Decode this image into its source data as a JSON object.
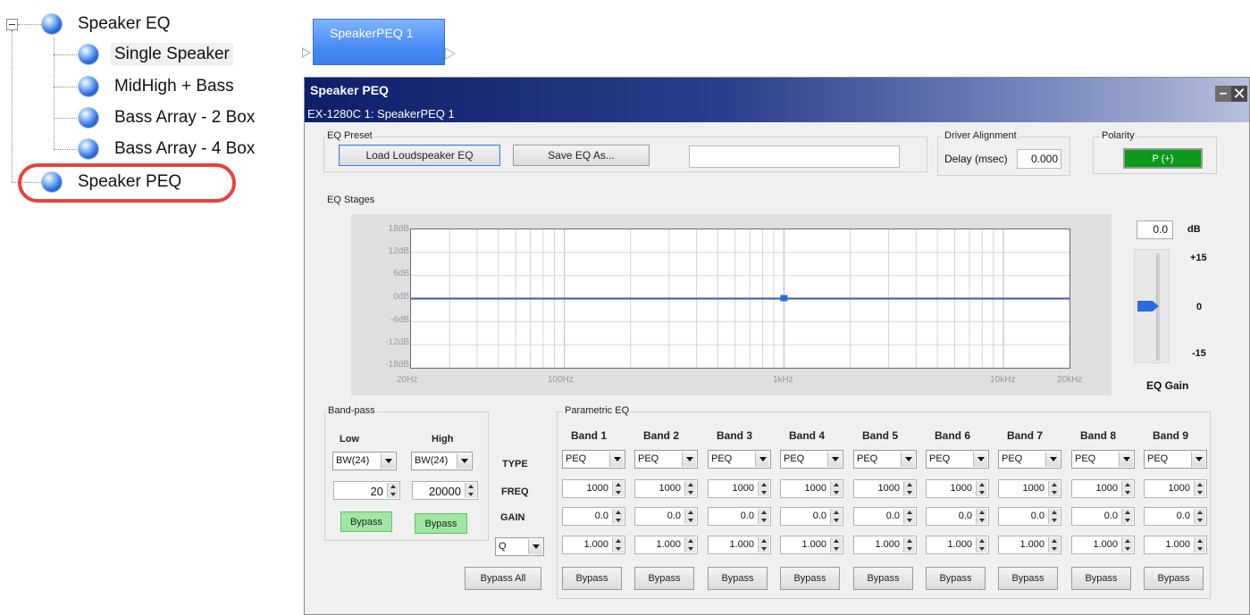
{
  "tree": {
    "root": "Speaker EQ",
    "children": [
      "Single Speaker",
      "MidHigh + Bass",
      "Bass Array - 2 Box",
      "Bass Array - 4 Box"
    ],
    "sibling": "Speaker PEQ"
  },
  "block": {
    "label": "SpeakerPEQ 1"
  },
  "dialog": {
    "title": "Speaker PEQ",
    "subtitle": "EX-1280C 1: SpeakerPEQ 1",
    "minimize": "–",
    "close": "✕",
    "eq_preset": {
      "label": "EQ Preset",
      "load_button": "Load Loudspeaker EQ",
      "save_button": "Save EQ As...",
      "preset_name": ""
    },
    "driver_alignment": {
      "label": "Driver Alignment",
      "delay_label": "Delay (msec)",
      "delay_value": "0.000"
    },
    "polarity": {
      "label": "Polarity",
      "value": "P (+)"
    },
    "eq_stages": {
      "label": "EQ Stages",
      "y_ticks": [
        "18dB",
        "12dB",
        "6dB",
        "0dB",
        "-6dB",
        "-12dB",
        "-18dB"
      ],
      "x_ticks": [
        "20Hz",
        "100Hz",
        "1kHz",
        "10kHz",
        "20kHz"
      ]
    },
    "eq_gain": {
      "value": "0.0",
      "unit": "dB",
      "scale_top": "+15",
      "scale_mid": "0",
      "scale_bottom": "-15",
      "label": "EQ Gain",
      "level": 0
    },
    "band_pass": {
      "label": "Band-pass",
      "low": {
        "label": "Low",
        "type": "BW(24)",
        "freq": "20",
        "bypass": "Bypass"
      },
      "high": {
        "label": "High",
        "type": "BW(24)",
        "freq": "20000",
        "bypass": "Bypass"
      }
    },
    "peq": {
      "label": "Parametric EQ",
      "row_labels": {
        "type": "TYPE",
        "freq": "FREQ",
        "gain": "GAIN",
        "q_mode": "Q"
      },
      "bypass_all": "Bypass All",
      "bands": [
        {
          "name": "Band 1",
          "type": "PEQ",
          "freq": "1000",
          "gain": "0.0",
          "q": "1.000",
          "bypass": "Bypass"
        },
        {
          "name": "Band 2",
          "type": "PEQ",
          "freq": "1000",
          "gain": "0.0",
          "q": "1.000",
          "bypass": "Bypass"
        },
        {
          "name": "Band 3",
          "type": "PEQ",
          "freq": "1000",
          "gain": "0.0",
          "q": "1.000",
          "bypass": "Bypass"
        },
        {
          "name": "Band 4",
          "type": "PEQ",
          "freq": "1000",
          "gain": "0.0",
          "q": "1.000",
          "bypass": "Bypass"
        },
        {
          "name": "Band 5",
          "type": "PEQ",
          "freq": "1000",
          "gain": "0.0",
          "q": "1.000",
          "bypass": "Bypass"
        },
        {
          "name": "Band 6",
          "type": "PEQ",
          "freq": "1000",
          "gain": "0.0",
          "q": "1.000",
          "bypass": "Bypass"
        },
        {
          "name": "Band 7",
          "type": "PEQ",
          "freq": "1000",
          "gain": "0.0",
          "q": "1.000",
          "bypass": "Bypass"
        },
        {
          "name": "Band 8",
          "type": "PEQ",
          "freq": "1000",
          "gain": "0.0",
          "q": "1.000",
          "bypass": "Bypass"
        },
        {
          "name": "Band 9",
          "type": "PEQ",
          "freq": "1000",
          "gain": "0.0",
          "q": "1.000",
          "bypass": "Bypass"
        }
      ]
    }
  },
  "colors": {
    "accent": "#2f5fd0",
    "polarity_green": "#0c9a1c",
    "bypass_green": "#9fe8a3",
    "highlight_ring": "#e8413a"
  }
}
